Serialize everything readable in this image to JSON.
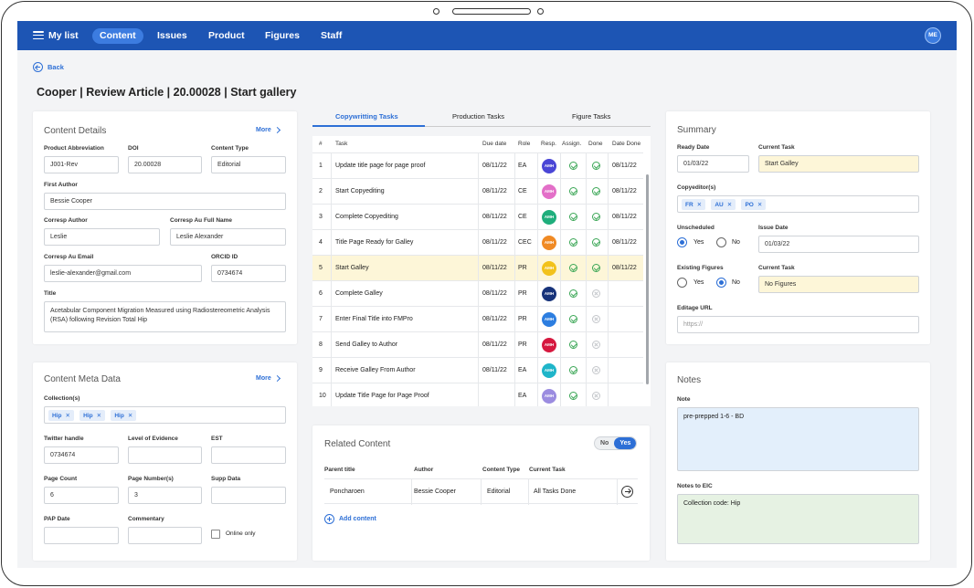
{
  "nav": {
    "my_list": "My list",
    "items": [
      "Content",
      "Issues",
      "Product",
      "Figures",
      "Staff"
    ],
    "avatar": "ME"
  },
  "back": "Back",
  "page_title": "Cooper | Review Article | 20.00028 | Start gallery",
  "content_details": {
    "title": "Content Details",
    "more": "More",
    "product_abbrev_label": "Product Abbreviation",
    "product_abbrev": "J001-Rev",
    "doi_label": "DOI",
    "doi": "20.00028",
    "content_type_label": "Content Type",
    "content_type": "Editorial",
    "first_author_label": "First Author",
    "first_author": "Bessie Cooper",
    "corresp_author_label": "Corresp Author",
    "corresp_author": "Leslie",
    "corresp_full_label": "Corresp Au Full Name",
    "corresp_full": "Leslie Alexander",
    "corresp_email_label": "Corresp Au Email",
    "corresp_email": "leslie-alexander@gmail.com",
    "orcid_label": "ORCID ID",
    "orcid": "0734674",
    "title_label": "Title",
    "article_title": "Acetabular Component Migration Measured using Radiostereometric Analysis (RSA) following Revision Total Hip"
  },
  "meta": {
    "title": "Content Meta Data",
    "more": "More",
    "collections_label": "Collection(s)",
    "collections": [
      "Hip",
      "Hip",
      "Hip"
    ],
    "twitter_label": "Twitter handle",
    "twitter": "0734674",
    "evidence_label": "Level of Evidence",
    "est_label": "EST",
    "page_count_label": "Page Count",
    "page_count": "6",
    "page_numbers_label": "Page Number(s)",
    "page_numbers": "3",
    "supp_label": "Supp Data",
    "pap_label": "PAP Date",
    "commentary_label": "Commentary",
    "online_only": "Online only"
  },
  "tabs": [
    "Copywritting Tasks",
    "Production Tasks",
    "Figure Tasks"
  ],
  "tasks": {
    "headers": [
      "#",
      "Task",
      "Due date",
      "Role",
      "Resp.",
      "Assign.",
      "Done",
      "Date Done"
    ],
    "rows": [
      {
        "n": "1",
        "task": "Update title page for page proof",
        "due": "08/11/22",
        "role": "EA",
        "resp": "AMH",
        "color": "#4a46d6",
        "assign": "ok",
        "done": "ok",
        "date": "08/11/22"
      },
      {
        "n": "2",
        "task": "Start Copyediting",
        "due": "08/11/22",
        "role": "CE",
        "resp": "AMH",
        "color": "#e36fc8",
        "assign": "ok",
        "done": "ok",
        "date": "08/11/22"
      },
      {
        "n": "3",
        "task": "Complete  Copyediting",
        "due": "08/11/22",
        "role": "CE",
        "resp": "AMH",
        "color": "#1fae7c",
        "assign": "ok",
        "done": "ok",
        "date": "08/11/22"
      },
      {
        "n": "4",
        "task": "Title Page Ready for Galley",
        "due": "08/11/22",
        "role": "CEC",
        "resp": "AMH",
        "color": "#f08a24",
        "assign": "ok",
        "done": "ok",
        "date": "08/11/22"
      },
      {
        "n": "5",
        "task": "Start Galley",
        "due": "08/11/22",
        "role": "PR",
        "resp": "AMH",
        "color": "#f2c21b",
        "assign": "ok",
        "done": "ok",
        "date": "08/11/22"
      },
      {
        "n": "6",
        "task": "Complete Galley",
        "due": "08/11/22",
        "role": "PR",
        "resp": "AMH",
        "color": "#17337a",
        "assign": "ok",
        "done": "no",
        "date": ""
      },
      {
        "n": "7",
        "task": "Enter Final Title into FMPro",
        "due": "08/11/22",
        "role": "PR",
        "resp": "AMH",
        "color": "#2d7ee0",
        "assign": "ok",
        "done": "no",
        "date": ""
      },
      {
        "n": "8",
        "task": "Send Galley to Author",
        "due": "08/11/22",
        "role": "PR",
        "resp": "AMH",
        "color": "#d6183f",
        "assign": "ok",
        "done": "no",
        "date": ""
      },
      {
        "n": "9",
        "task": "Receive Galley From Author",
        "due": "08/11/22",
        "role": "EA",
        "resp": "AMH",
        "color": "#1fb5c9",
        "assign": "ok",
        "done": "no",
        "date": ""
      },
      {
        "n": "10",
        "task": "Update Title Page for Page Proof",
        "due": "",
        "role": "EA",
        "resp": "AMH",
        "color": "#9b8ce0",
        "assign": "ok",
        "done": "no",
        "date": ""
      }
    ]
  },
  "related": {
    "title": "Related Content",
    "toggle_no": "No",
    "toggle_yes": "Yes",
    "headers": [
      "Parent title",
      "Author",
      "Content Type",
      "Current Task"
    ],
    "row": [
      "Poncharoen",
      "Bessie Cooper",
      "Editorial",
      "All Tasks Done"
    ],
    "add": "Add content"
  },
  "summary": {
    "title": "Summary",
    "ready_label": "Ready Date",
    "ready": "01/03/22",
    "current_task_label": "Current Task",
    "current_task": "Start Galley",
    "copyeditors_label": "Copyeditor(s)",
    "copyeditors": [
      "FR",
      "AU",
      "PO"
    ],
    "unscheduled_label": "Unscheduled",
    "yes": "Yes",
    "no": "No",
    "issue_date_label": "Issue Date",
    "issue_date": "01/03/22",
    "figures_label": "Existing Figures",
    "current_task2_label": "Current Task",
    "current_task2": "No Figures",
    "editage_label": "Editage URL",
    "editage_placeholder": "https://"
  },
  "notes": {
    "title": "Notes",
    "note_label": "Note",
    "note": "pre-prepped 1-6 - BD",
    "eic_label": "Notes to EIC",
    "eic": "Collection code: Hip"
  }
}
